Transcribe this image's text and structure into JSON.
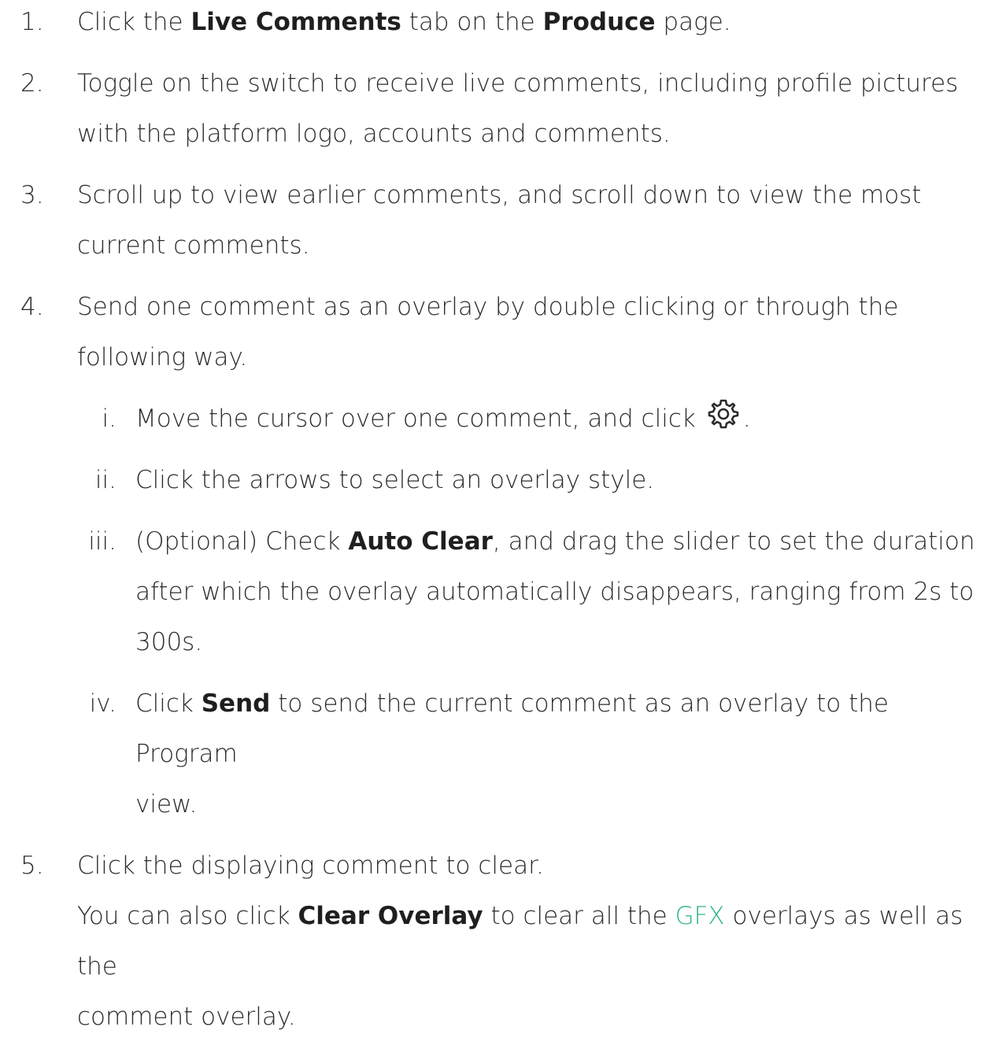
{
  "steps": [
    {
      "num": "1.",
      "parts": [
        "Click the ",
        "Live Comments",
        " tab on the ",
        "Produce",
        " page."
      ]
    },
    {
      "num": "2.",
      "line1": "Toggle on the switch to receive live comments, including profile pictures",
      "line2": "with the platform logo, accounts and comments."
    },
    {
      "num": "3.",
      "line1": "Scroll up to view earlier comments, and scroll down to view the most",
      "line2": "current comments."
    },
    {
      "num": "4.",
      "line1": "Send one comment as an overlay by double clicking or through the",
      "line2": "following way."
    },
    {
      "num": "5.",
      "line1": "Click the displaying comment to clear.",
      "line2_parts": [
        "You can also click ",
        "Clear Overlay",
        " to clear all the ",
        "GFX",
        " overlays as well as the"
      ],
      "line3": "comment overlay."
    }
  ],
  "substeps": [
    {
      "num": "i.",
      "before_icon": "Move the cursor over one comment, and click",
      "icon": "gear-icon",
      "after_icon": "."
    },
    {
      "num": "ii.",
      "text": "Click the arrows to select an overlay style."
    },
    {
      "num": "iii.",
      "line1_parts": [
        "(Optional) Check ",
        "Auto Clear",
        ", and drag the slider to set the duration"
      ],
      "line2": "after which the overlay automatically disappears, ranging from 2s to",
      "line3": "300s."
    },
    {
      "num": "iv.",
      "line1_parts": [
        "Click ",
        "Send",
        " to send the current comment as an overlay to the Program"
      ],
      "line2": "view."
    }
  ],
  "colors": {
    "text": "#2b2b2b",
    "link": "#2fb58a"
  }
}
